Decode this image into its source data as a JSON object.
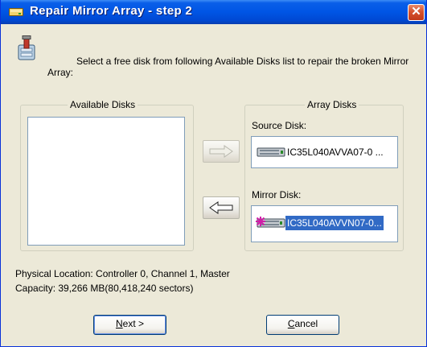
{
  "window": {
    "title": "Repair Mirror Array - step 2",
    "close_icon": "close-icon"
  },
  "intro": {
    "text": "Select a free disk from following Available Disks list to repair the broken Mirror Array:"
  },
  "available_disks": {
    "title": "Available Disks",
    "items": []
  },
  "array_disks": {
    "title": "Array Disks",
    "source_label": "Source Disk:",
    "source_disk": "IC35L040AVVA07-0 ...",
    "mirror_label": "Mirror Disk:",
    "mirror_disk": "IC35L040AVVN07-0..."
  },
  "arrows": {
    "add": "arrow-right-icon",
    "remove": "arrow-left-icon"
  },
  "details": {
    "location": "Physical Location: Controller 0, Channel 1, Master",
    "capacity": "Capacity: 39,266 MB(80,418,240 sectors)"
  },
  "buttons": {
    "next_mnemonic": "N",
    "next_rest": "ext >",
    "cancel_mnemonic": "C",
    "cancel_rest": "ancel"
  },
  "colors": {
    "title_bar": "#0055E5",
    "selection": "#316AC5",
    "face": "#ECE9D8"
  }
}
